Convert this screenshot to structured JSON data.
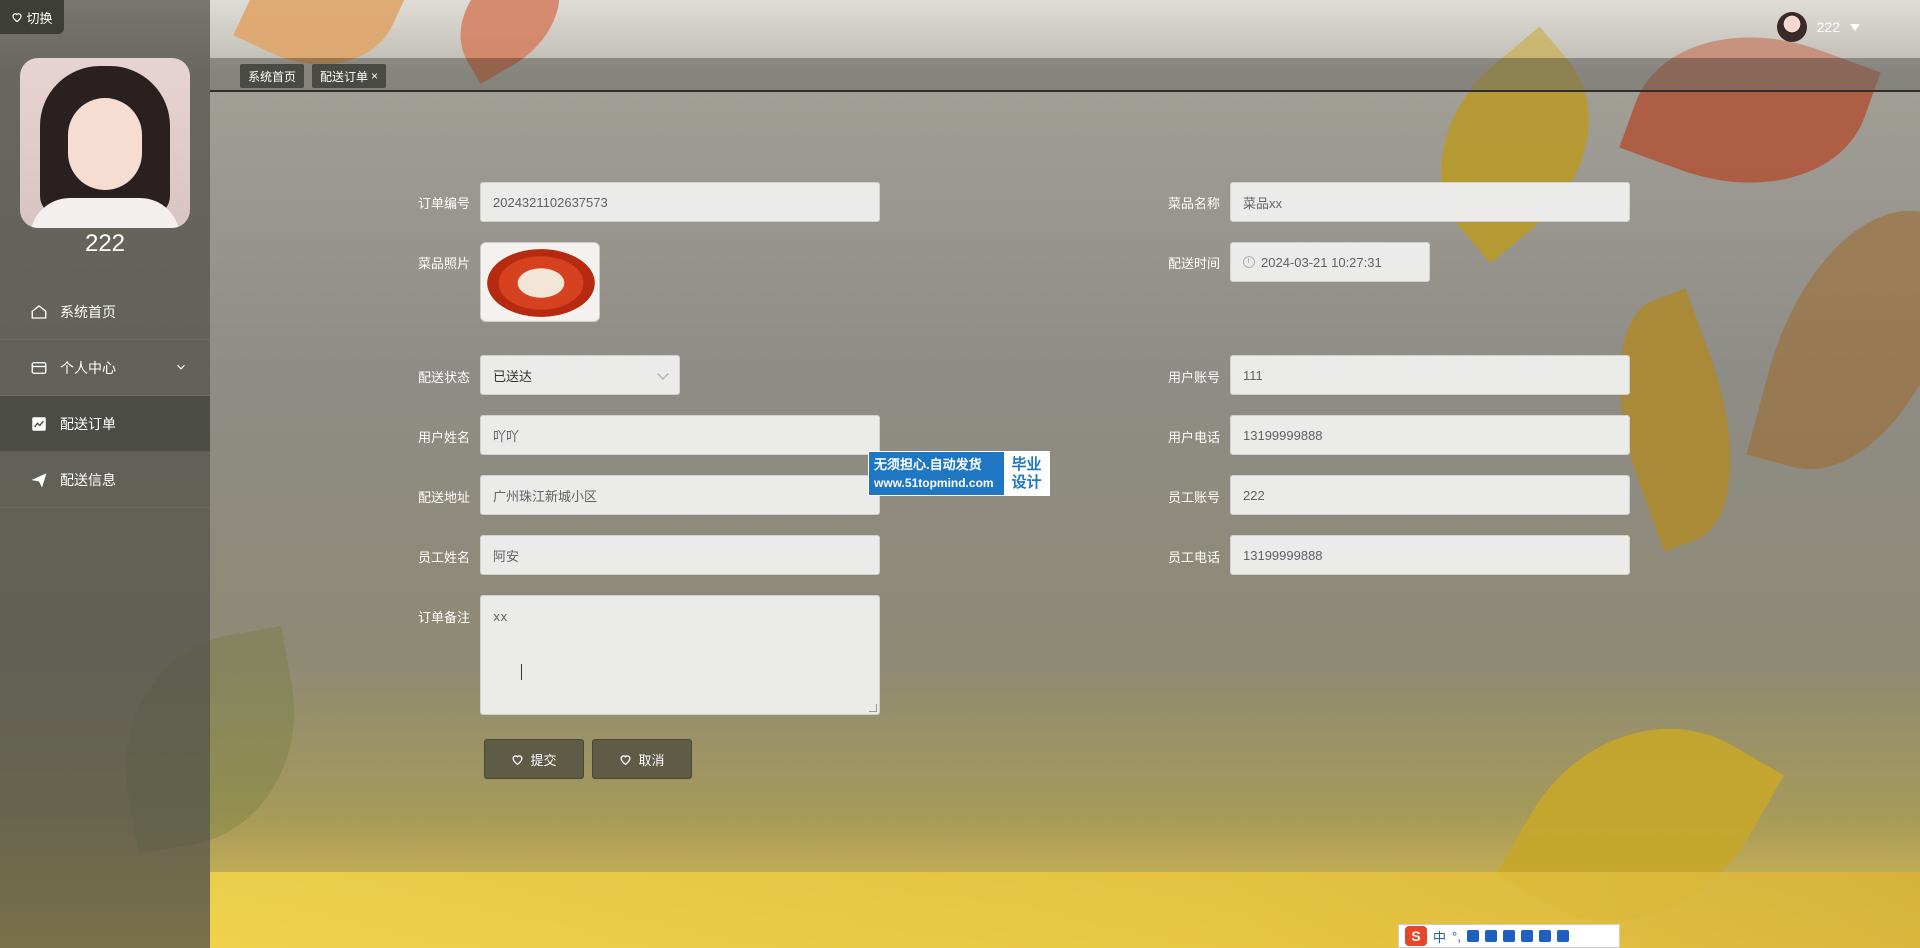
{
  "header": {
    "toggle_label": "切换",
    "username": "222"
  },
  "sidebar": {
    "username": "222",
    "items": [
      {
        "label": "系统首页",
        "icon": "home-icon"
      },
      {
        "label": "个人中心",
        "icon": "wallet-icon"
      },
      {
        "label": "配送订单",
        "icon": "chart-icon"
      },
      {
        "label": "配送信息",
        "icon": "send-icon"
      }
    ]
  },
  "tabs": [
    {
      "label": "系统首页"
    },
    {
      "label": "配送订单",
      "close": "×"
    }
  ],
  "form": {
    "order_no": {
      "label": "订单编号",
      "value": "2024321102637573"
    },
    "dish_name": {
      "label": "菜品名称",
      "value": "菜品xx"
    },
    "dish_photo": {
      "label": "菜品照片"
    },
    "delivery_time": {
      "label": "配送时间",
      "value": "2024-03-21 10:27:31"
    },
    "delivery_status": {
      "label": "配送状态",
      "value": "已送达"
    },
    "user_account": {
      "label": "用户账号",
      "value": "111"
    },
    "user_name": {
      "label": "用户姓名",
      "value": "吖吖"
    },
    "user_phone": {
      "label": "用户电话",
      "value": "13199999888"
    },
    "address": {
      "label": "配送地址",
      "value": "广州珠江新城小区"
    },
    "staff_account": {
      "label": "员工账号",
      "value": "222"
    },
    "staff_name": {
      "label": "员工姓名",
      "value": "阿安"
    },
    "staff_phone": {
      "label": "员工电话",
      "value": "13199999888"
    },
    "remark": {
      "label": "订单备注",
      "value": "xx"
    }
  },
  "buttons": {
    "submit": "提交",
    "cancel": "取消"
  },
  "watermark": {
    "line1": "无须担心.自动发货",
    "url": "www.51topmind.com",
    "tag1": "毕业",
    "tag2": "设计"
  },
  "ime": {
    "logo": "S",
    "mode": "中",
    "punct": "°,"
  },
  "colors": {
    "sidebar": "#50504a",
    "button": "#5e5b46",
    "badge": "#1f76c2"
  }
}
